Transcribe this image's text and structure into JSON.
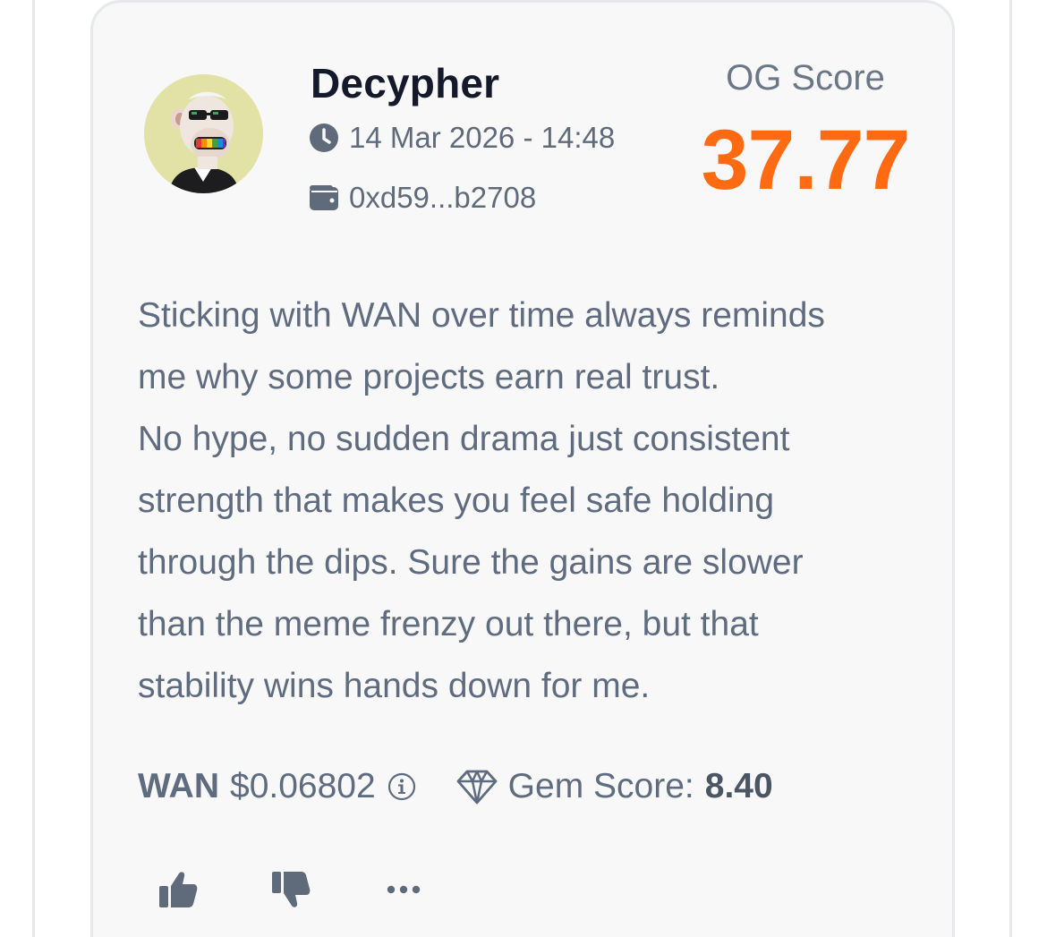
{
  "post": {
    "username": "Decypher",
    "date": "14 Mar 2026 - 14:48",
    "wallet": "0xd59...b2708",
    "og_score_label": "OG Score",
    "og_score_value": "37.77",
    "text_lines": [
      "Sticking with WAN over time always reminds",
      "me why some projects earn real trust.",
      "No hype, no sudden drama just consistent",
      "strength that makes you feel safe holding",
      "through the dips. Sure the gains are slower",
      "than the meme frenzy out there, but that",
      "stability wins hands down for me."
    ],
    "token": {
      "symbol": "WAN",
      "price": "$0.06802",
      "gem_score_label": "Gem Score:",
      "gem_score_value": "8.40"
    },
    "icons": {
      "date": "clock-icon",
      "wallet": "wallet-icon",
      "info": "info-icon",
      "gem": "diamond-icon",
      "like": "thumbs-up-icon",
      "dislike": "thumbs-down-icon",
      "more": "ellipsis-icon"
    },
    "colors": {
      "og_score": "#ff6a13",
      "text": "#5f6b7f",
      "card_bg": "#f8f8f8",
      "icon": "#5f6b7a"
    }
  }
}
